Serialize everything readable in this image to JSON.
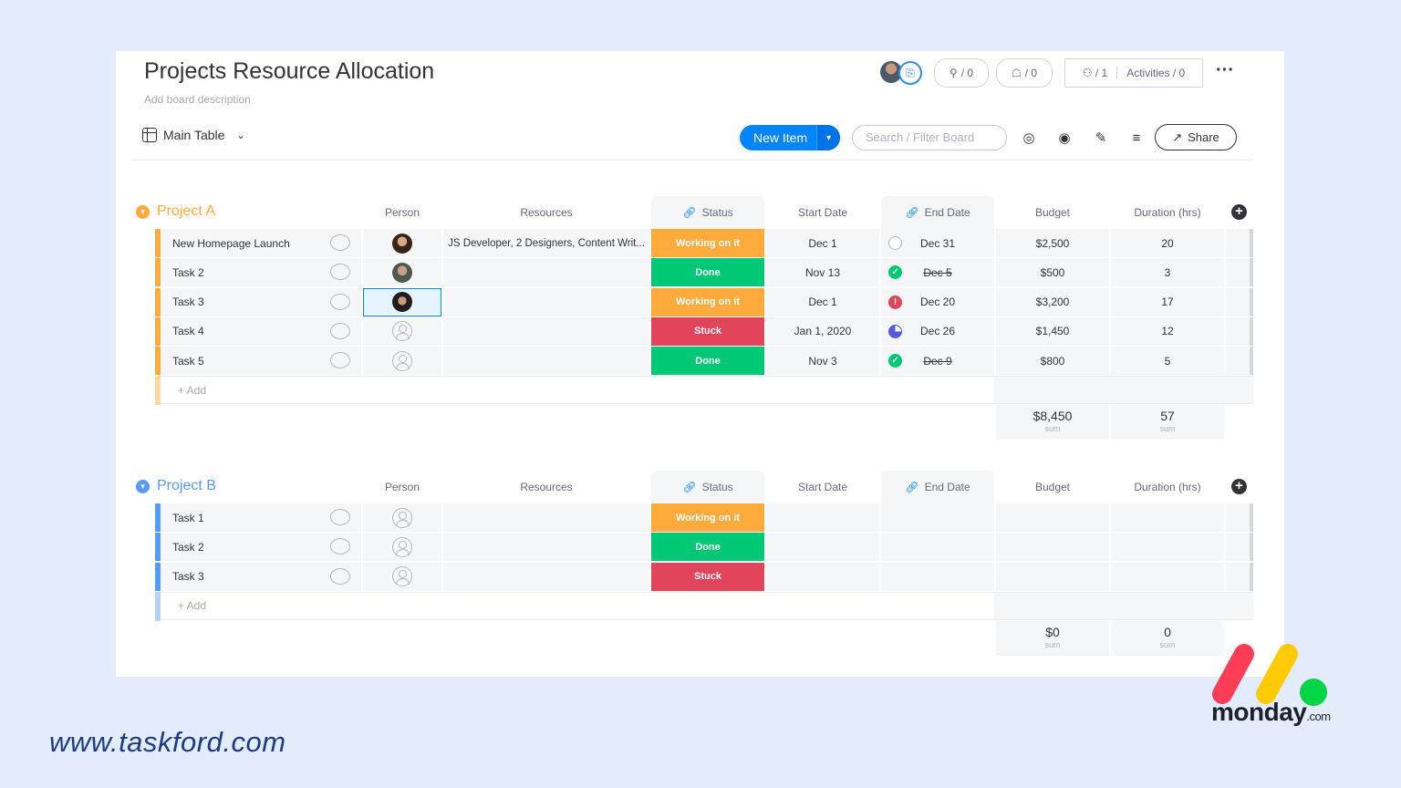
{
  "board": {
    "title": "Projects Resource Allocation",
    "description": "Add board description",
    "view_label": "Main Table",
    "integrations_count": "/ 0",
    "automations_count": "/ 0",
    "members_count": "/ 1",
    "activities_label": "Activities / 0"
  },
  "toolbar": {
    "new_item_label": "New Item",
    "search_placeholder": "Search / Filter Board",
    "share_label": "Share"
  },
  "columns": {
    "person": "Person",
    "resources": "Resources",
    "status": "Status",
    "start_date": "Start Date",
    "end_date": "End Date",
    "budget": "Budget",
    "duration": "Duration (hrs)"
  },
  "colors": {
    "project_a": "#fdab3d",
    "project_b": "#579bfc",
    "working": "#fdab3d",
    "done": "#00c875",
    "stuck": "#e2445c",
    "primary": "#0085ff"
  },
  "groups": [
    {
      "name": "Project A",
      "add_label": "+ Add",
      "rows": [
        {
          "name": "New Homepage Launch",
          "resources": "JS Developer, 2 Designers, Content Writ...",
          "status": "Working on it",
          "start": "Dec 1",
          "end": "Dec 31",
          "budget": "$2,500",
          "duration": "20"
        },
        {
          "name": "Task 2",
          "resources": "",
          "status": "Done",
          "start": "Nov 13",
          "end": "Dec 5",
          "budget": "$500",
          "duration": "3"
        },
        {
          "name": "Task 3",
          "resources": "",
          "status": "Working on it",
          "start": "Dec 1",
          "end": "Dec 20",
          "budget": "$3,200",
          "duration": "17"
        },
        {
          "name": "Task 4",
          "resources": "",
          "status": "Stuck",
          "start": "Jan 1, 2020",
          "end": "Dec 26",
          "budget": "$1,450",
          "duration": "12"
        },
        {
          "name": "Task 5",
          "resources": "",
          "status": "Done",
          "start": "Nov 3",
          "end": "Dec 9",
          "budget": "$800",
          "duration": "5"
        }
      ],
      "sum_budget": "$8,450",
      "sum_duration": "57",
      "sum_label": "sum"
    },
    {
      "name": "Project B",
      "add_label": "+ Add",
      "rows": [
        {
          "name": "Task 1",
          "status": "Working on it"
        },
        {
          "name": "Task 2",
          "status": "Done"
        },
        {
          "name": "Task 3",
          "status": "Stuck"
        }
      ],
      "sum_budget": "$0",
      "sum_duration": "0",
      "sum_label": "sum"
    }
  ],
  "footer": {
    "url": "www.taskford.com",
    "logo_word": "monday",
    "logo_suffix": ".com"
  }
}
